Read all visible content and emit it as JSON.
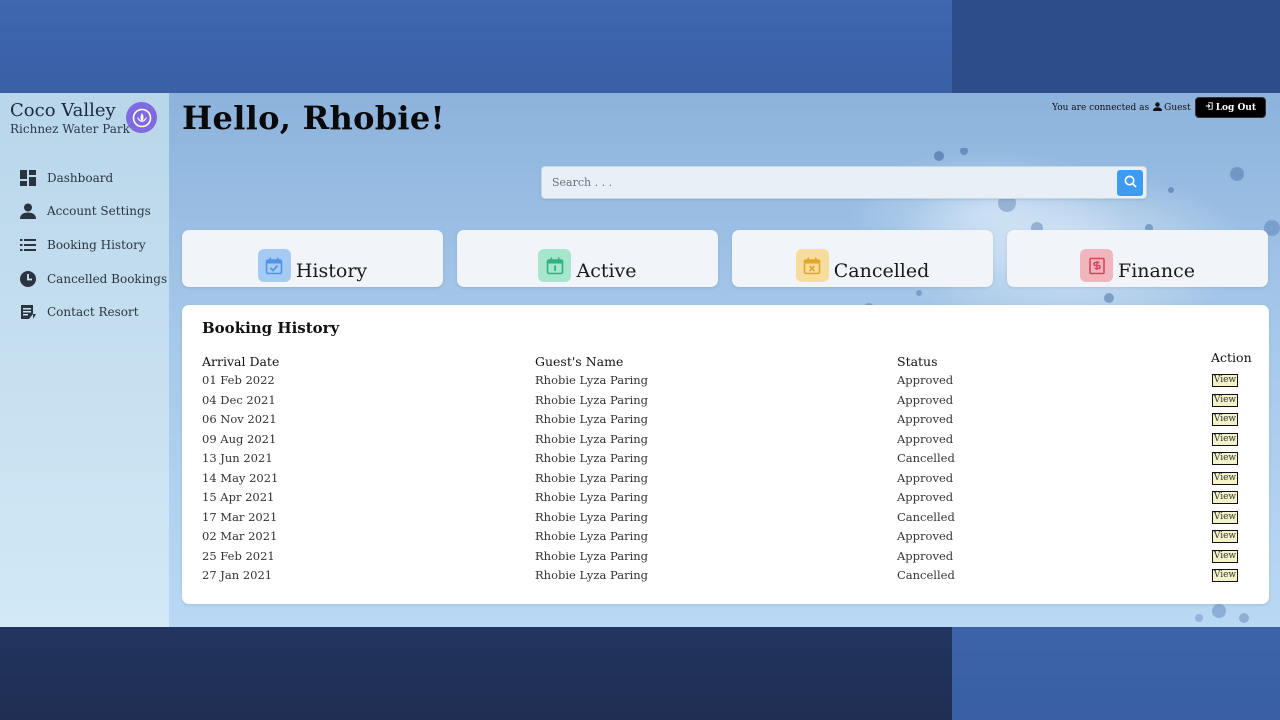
{
  "brand": {
    "title": "Coco Valley",
    "subtitle": "Richnez Water Park",
    "logo_icon": "lotus-logo-icon",
    "logo_color": "#7f6ae0"
  },
  "sidebar": {
    "items": [
      {
        "label": "Dashboard",
        "icon": "dashboard-icon"
      },
      {
        "label": "Account Settings",
        "icon": "user-icon"
      },
      {
        "label": "Booking History",
        "icon": "list-icon"
      },
      {
        "label": "Cancelled Bookings",
        "icon": "clock-icon"
      },
      {
        "label": "Contact Resort",
        "icon": "contact-icon"
      }
    ]
  },
  "header": {
    "greeting": "Hello, Rhobie!",
    "connected_text": "You are connected as",
    "user_name": "Guest",
    "logout_label": "Log Out"
  },
  "search": {
    "placeholder": "Search . . ."
  },
  "cards": [
    {
      "label": "History",
      "icon": "calendar-check-icon",
      "color": "#6aa8f0"
    },
    {
      "label": "Active",
      "icon": "calendar-active-icon",
      "color": "#49c89a"
    },
    {
      "label": "Cancelled",
      "icon": "calendar-x-icon",
      "color": "#f2c14a"
    },
    {
      "label": "Finance",
      "icon": "money-icon",
      "color": "#e0687a"
    }
  ],
  "table": {
    "title": "Booking History",
    "headers": {
      "arrival": "Arrival Date",
      "guest": "Guest's Name",
      "status": "Status",
      "action": "Action"
    },
    "view_label": "View",
    "rows": [
      {
        "arrival": "01 Feb 2022",
        "guest": "Rhobie Lyza Paring",
        "status": "Approved"
      },
      {
        "arrival": "04 Dec 2021",
        "guest": "Rhobie Lyza Paring",
        "status": "Approved"
      },
      {
        "arrival": "06 Nov 2021",
        "guest": "Rhobie Lyza Paring",
        "status": "Approved"
      },
      {
        "arrival": "09 Aug 2021",
        "guest": "Rhobie Lyza Paring",
        "status": "Approved"
      },
      {
        "arrival": "13 Jun 2021",
        "guest": "Rhobie Lyza Paring",
        "status": "Cancelled"
      },
      {
        "arrival": "14 May 2021",
        "guest": "Rhobie Lyza Paring",
        "status": "Approved"
      },
      {
        "arrival": "15 Apr 2021",
        "guest": "Rhobie Lyza Paring",
        "status": "Approved"
      },
      {
        "arrival": "17 Mar 2021",
        "guest": "Rhobie Lyza Paring",
        "status": "Cancelled"
      },
      {
        "arrival": "02 Mar 2021",
        "guest": "Rhobie Lyza Paring",
        "status": "Approved"
      },
      {
        "arrival": "25 Feb 2021",
        "guest": "Rhobie Lyza Paring",
        "status": "Approved"
      },
      {
        "arrival": "27 Jan 2021",
        "guest": "Rhobie Lyza Paring",
        "status": "Cancelled"
      }
    ]
  }
}
